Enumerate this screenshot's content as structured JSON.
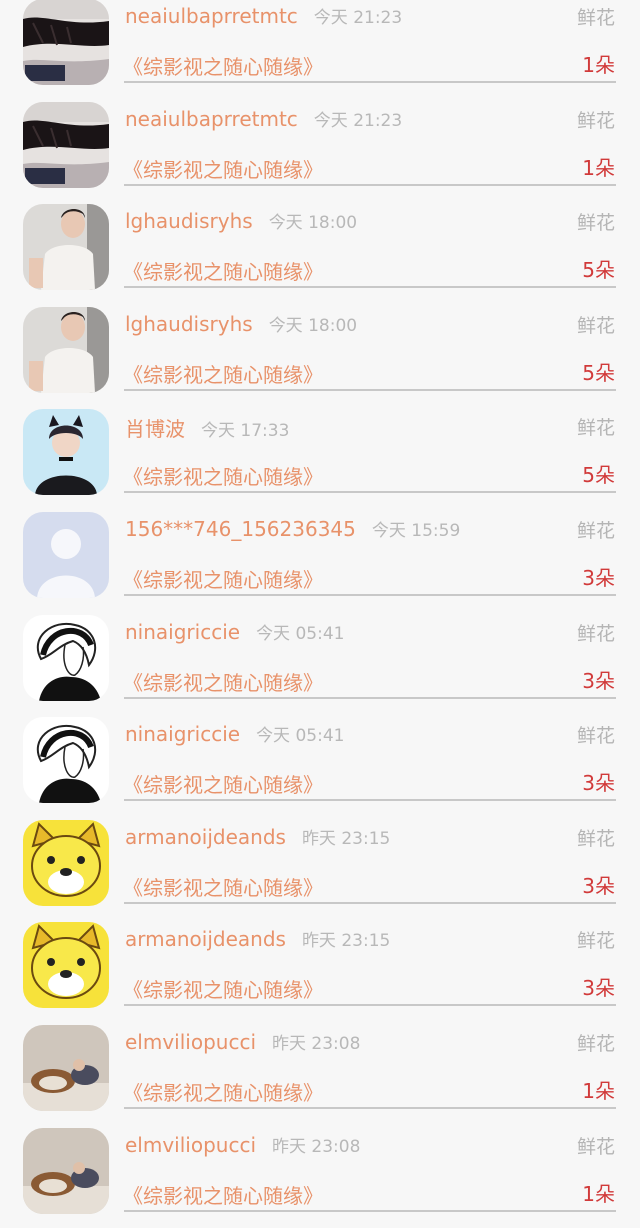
{
  "gifts": [
    {
      "name": "neaiulbaprretmtc",
      "time": "今天 21:23",
      "type": "鲜花",
      "work": "《综影视之随心随缘》",
      "count": "1朵",
      "avatar": "dark-hair-avatar"
    },
    {
      "name": "neaiulbaprretmtc",
      "time": "今天 21:23",
      "type": "鲜花",
      "work": "《综影视之随心随缘》",
      "count": "1朵",
      "avatar": "dark-hair-avatar"
    },
    {
      "name": "lghaudisryhs",
      "time": "今天 18:00",
      "type": "鲜花",
      "work": "《综影视之随心随缘》",
      "count": "5朵",
      "avatar": "young-man-avatar"
    },
    {
      "name": "lghaudisryhs",
      "time": "今天 18:00",
      "type": "鲜花",
      "work": "《综影视之随心随缘》",
      "count": "5朵",
      "avatar": "young-man-avatar"
    },
    {
      "name": "肖博波",
      "time": "今天 17:33",
      "type": "鲜花",
      "work": "《综影视之随心随缘》",
      "count": "5朵",
      "avatar": "cat-ears-avatar"
    },
    {
      "name": "156***746_156236345",
      "time": "今天 15:59",
      "type": "鲜花",
      "work": "《综影视之随心随缘》",
      "count": "3朵",
      "avatar": "default-avatar"
    },
    {
      "name": "ninaigriccie",
      "time": "今天 05:41",
      "type": "鲜花",
      "work": "《综影视之随心随缘》",
      "count": "3朵",
      "avatar": "sketch-girl-avatar"
    },
    {
      "name": "ninaigriccie",
      "time": "今天 05:41",
      "type": "鲜花",
      "work": "《综影视之随心随缘》",
      "count": "3朵",
      "avatar": "sketch-girl-avatar"
    },
    {
      "name": "armanoijdeands",
      "time": "昨天 23:15",
      "type": "鲜花",
      "work": "《综影视之随心随缘》",
      "count": "3朵",
      "avatar": "doge-avatar"
    },
    {
      "name": "armanoijdeands",
      "time": "昨天 23:15",
      "type": "鲜花",
      "work": "《综影视之随心随缘》",
      "count": "3朵",
      "avatar": "doge-avatar"
    },
    {
      "name": "elmviliopucci",
      "time": "昨天 23:08",
      "type": "鲜花",
      "work": "《综影视之随心随缘》",
      "count": "1朵",
      "avatar": "dogs-photo-avatar"
    },
    {
      "name": "elmviliopucci",
      "time": "昨天 23:08",
      "type": "鲜花",
      "work": "《综影视之随心随缘》",
      "count": "1朵",
      "avatar": "dogs-photo-avatar"
    }
  ],
  "colors": {
    "name": "#e8926a",
    "count": "#d13a3a",
    "meta": "#b8b8b8",
    "background": "#f7f7f7"
  }
}
